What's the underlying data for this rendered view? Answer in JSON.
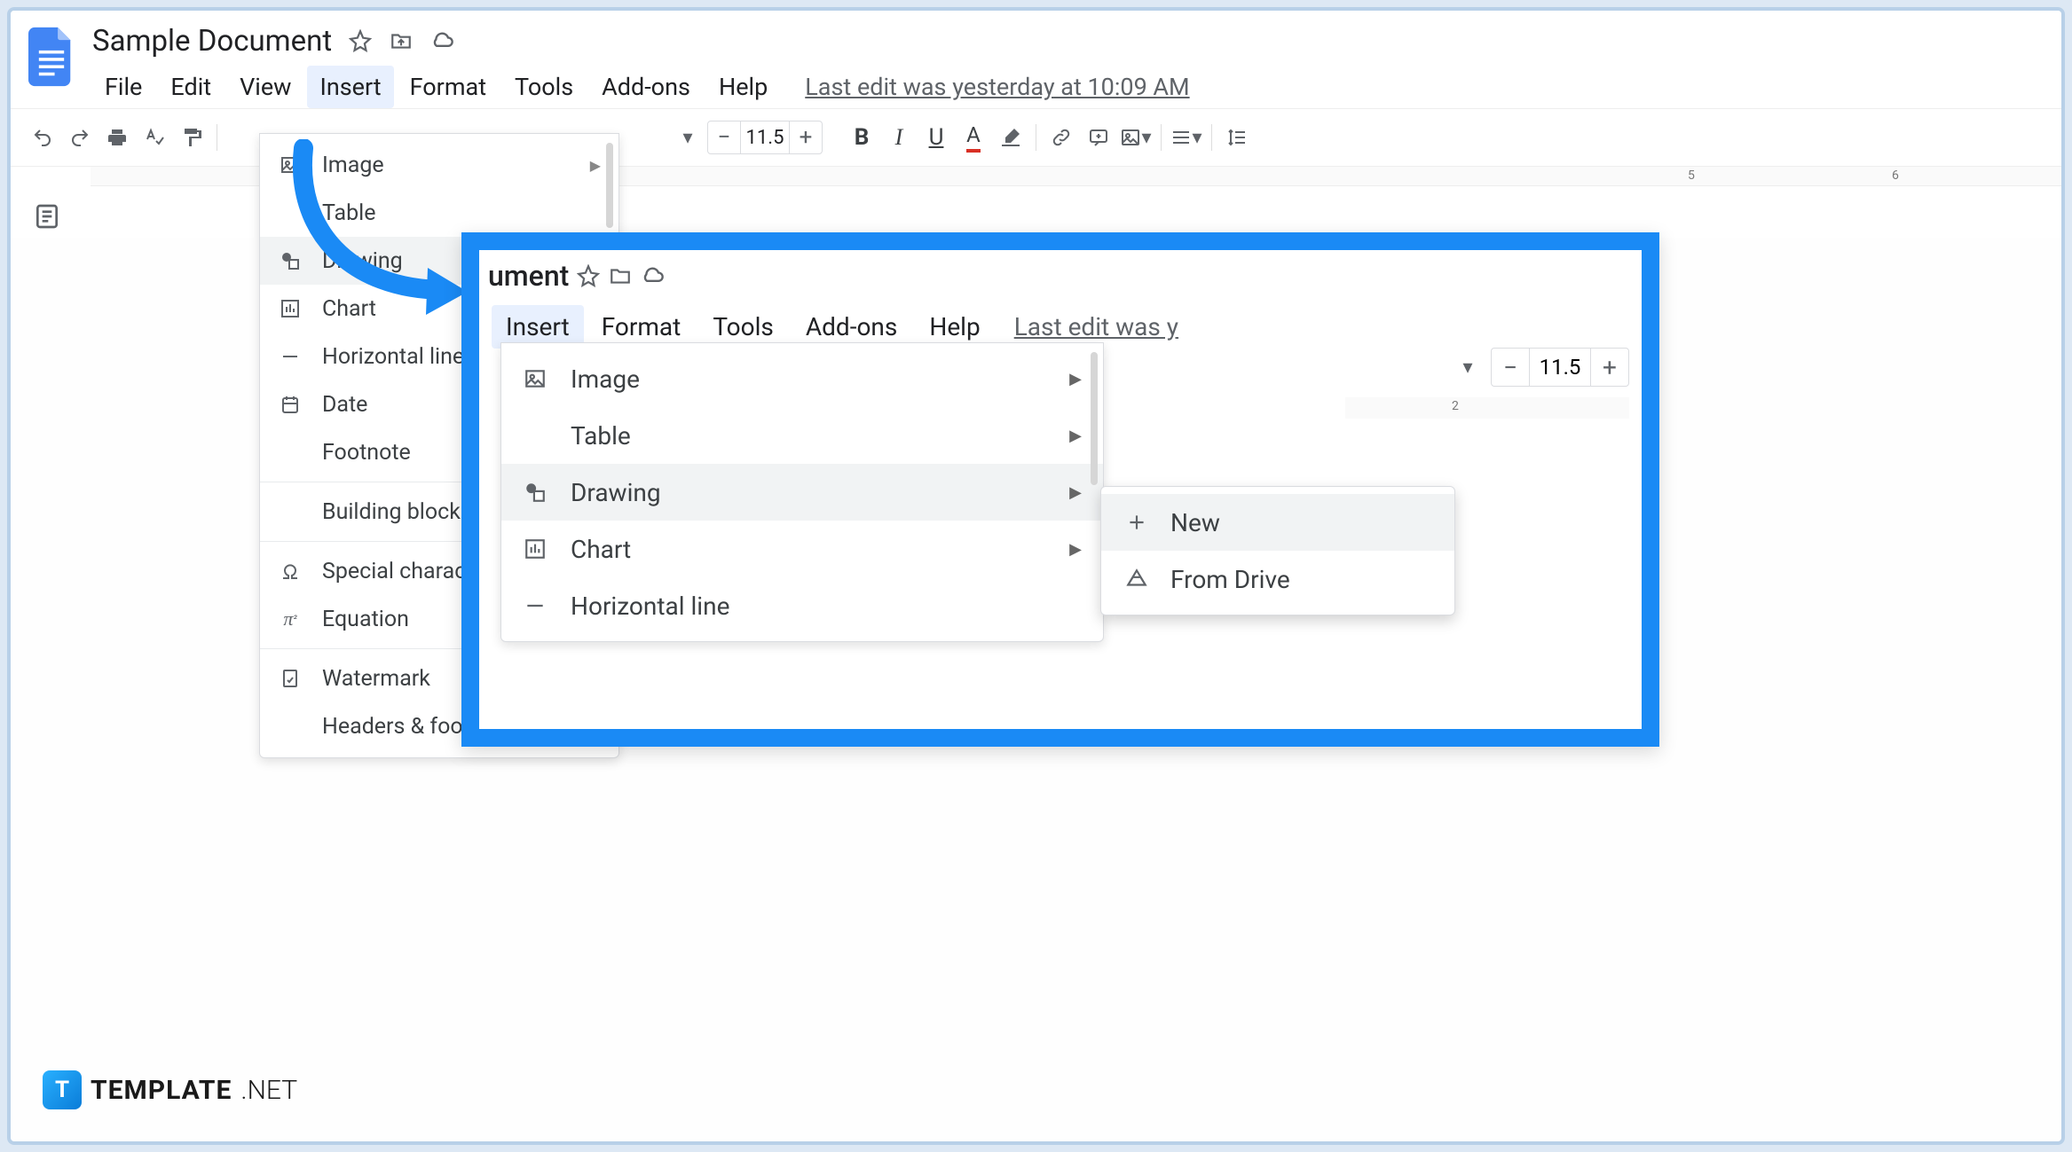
{
  "header": {
    "doc_title": "Sample Document",
    "menus": {
      "file": "File",
      "edit": "Edit",
      "view": "View",
      "insert": "Insert",
      "format": "Format",
      "tools": "Tools",
      "addons": "Add-ons",
      "help": "Help"
    },
    "last_edit": "Last edit was yesterday at 10:09 AM"
  },
  "toolbar": {
    "font_size": "11.5"
  },
  "insert_menu": {
    "items": {
      "image": "Image",
      "table": "Table",
      "drawing": "Drawing",
      "chart": "Chart",
      "horizontal_line": "Horizontal line",
      "date": "Date",
      "footnote": "Footnote",
      "building_blocks": "Building blocks",
      "special_characters": "Special characters",
      "equation": "Equation",
      "watermark": "Watermark",
      "headers_footers": "Headers & footers"
    }
  },
  "inset": {
    "title_fragment": "ument",
    "menus": {
      "insert": "Insert",
      "format": "Format",
      "tools": "Tools",
      "addons": "Add-ons",
      "help": "Help"
    },
    "last_edit_fragment": "Last edit was y",
    "font_size": "11.5",
    "ruler_mark": "2",
    "insert_items": {
      "image": "Image",
      "table": "Table",
      "drawing": "Drawing",
      "chart": "Chart",
      "horizontal_line": "Horizontal line"
    },
    "drawing_submenu": {
      "new": "New",
      "from_drive": "From Drive"
    }
  },
  "ruler": {
    "mark5": "5",
    "mark6": "6"
  },
  "watermark": {
    "badge": "T",
    "text1": "TEMPLATE",
    "text2": ".NET"
  }
}
